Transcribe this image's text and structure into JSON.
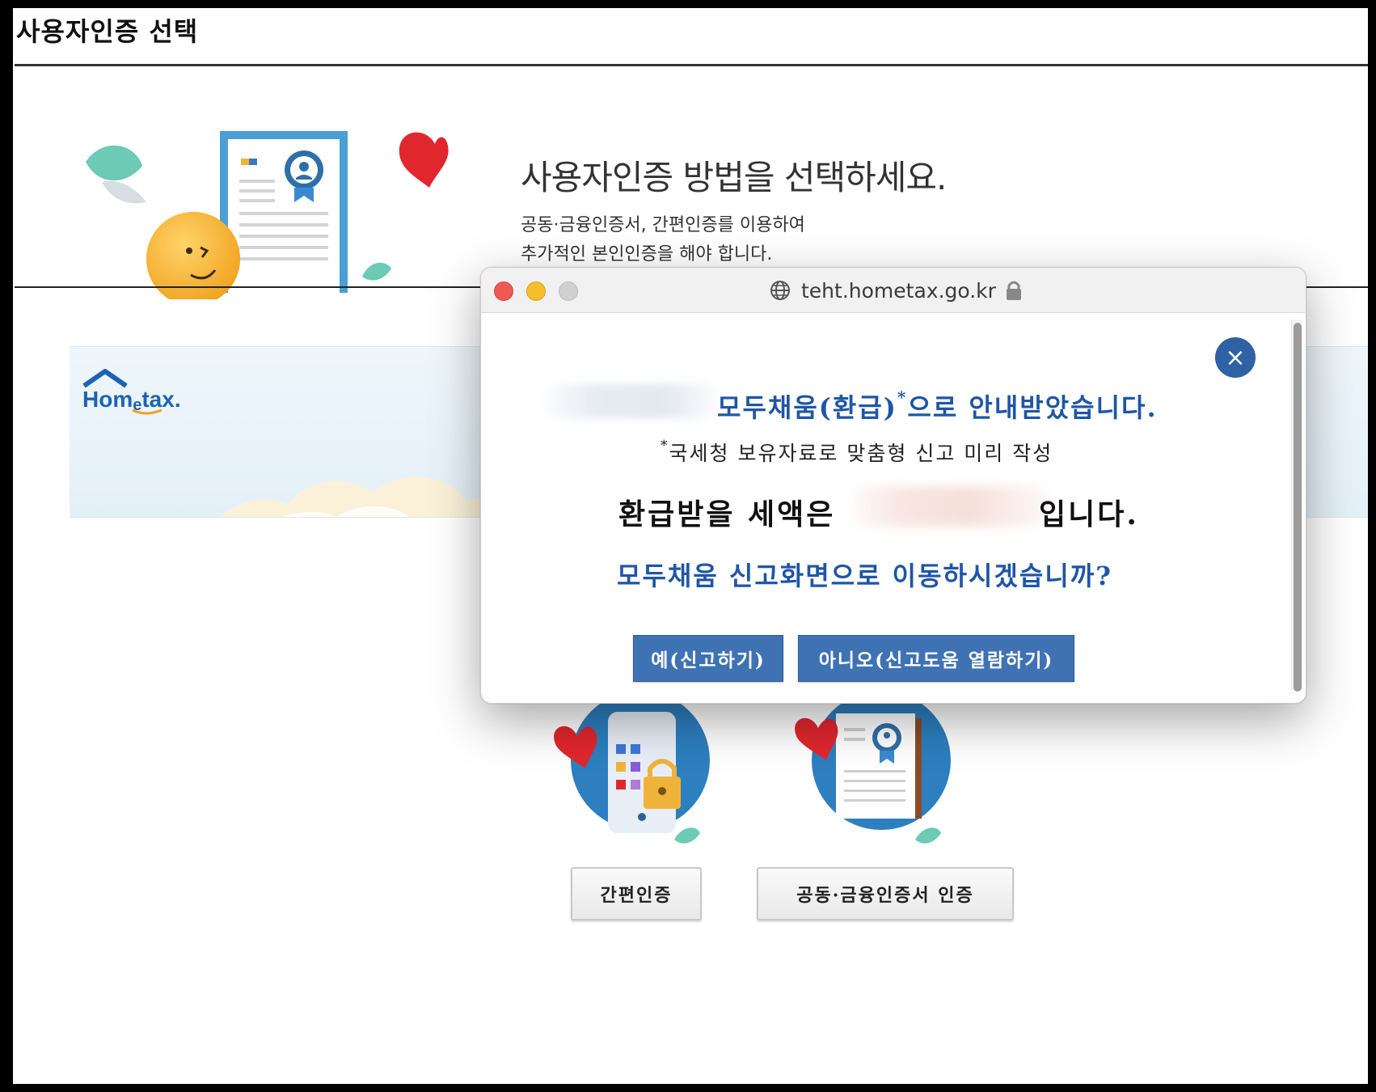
{
  "page": {
    "title": "사용자인증 선택",
    "headline": "사용자인증 방법을 선택하세요.",
    "description_line1": "공동·금융인증서, 간편인증를 이용하여",
    "description_line2": "추가적인 본인인증을 해야 합니다."
  },
  "banner": {
    "logo_text_1": "Hom",
    "logo_text_2": "e",
    "logo_text_3": "tax."
  },
  "auth_options": {
    "simple_label": "간편인증",
    "certificate_label": "공동·금융인증서 인증"
  },
  "popup": {
    "url": "teht.hometax.go.kr",
    "line1": "모두채움(환급)",
    "line1_star": "*",
    "line1_end": "으로 안내받았습니다.",
    "line2_star": "*",
    "line2": "국세청 보유자료로 맞춤형 신고 미리 작성",
    "line3_start": "환급받을 세액은",
    "line3_end": "입니다.",
    "line4": "모두채움 신고화면으로 이동하시겠습니까?",
    "yes_label": "예(신고하기)",
    "no_label": "아니오(신고도움 열람하기)",
    "close_symbol": "×"
  },
  "colors": {
    "accent_blue": "#1f56a6",
    "button_blue": "#3f72b3",
    "close_blue": "#2e62a5",
    "traffic_red": "#ee5a52",
    "traffic_yellow": "#f5be2e",
    "traffic_gray": "#d0d0d0"
  },
  "icons": {
    "globe": "globe-icon",
    "lock": "lock-icon",
    "close": "close-icon"
  }
}
